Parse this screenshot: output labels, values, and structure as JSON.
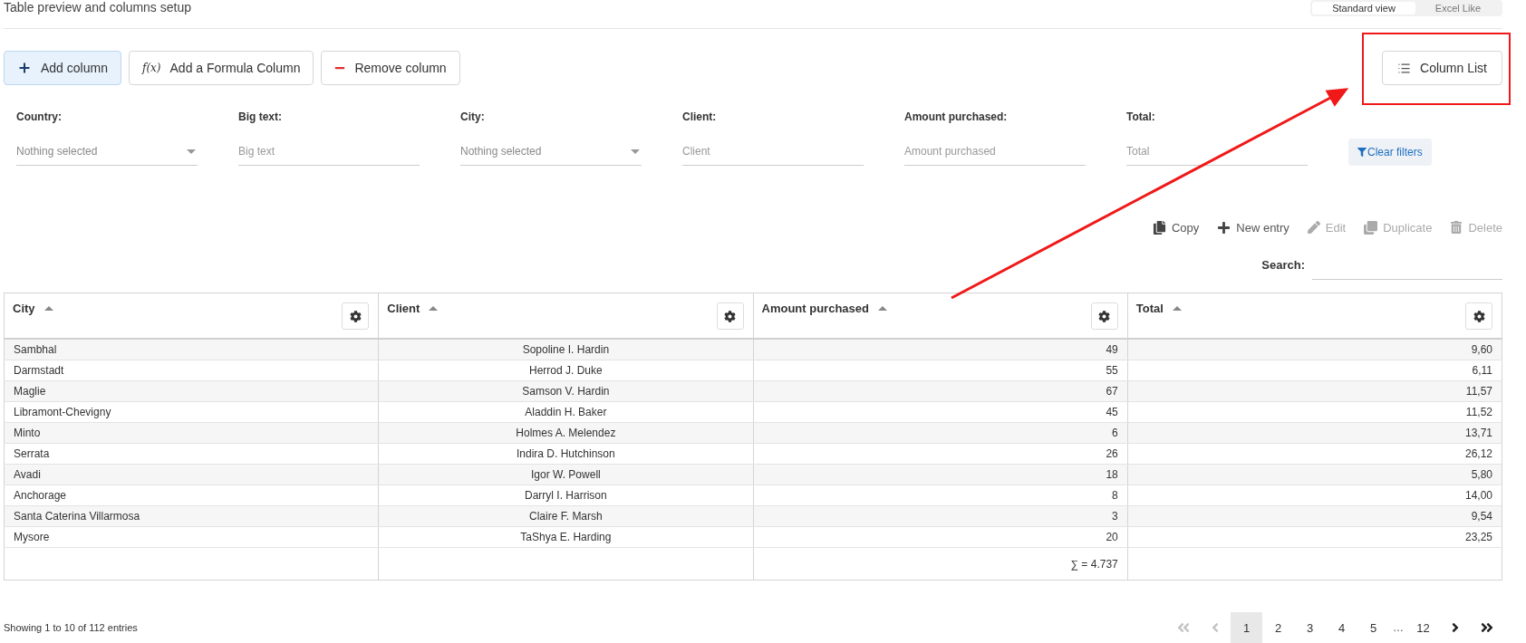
{
  "header": {
    "title": "Table preview and columns setup",
    "view_toggle": [
      {
        "label": "Standard view",
        "selected": true
      },
      {
        "label": "Excel Like",
        "selected": false
      }
    ]
  },
  "column_buttons": [
    {
      "kind": "add",
      "label": "Add column"
    },
    {
      "kind": "formula",
      "icon_text": "f(x)",
      "label": "Add a Formula Column"
    },
    {
      "kind": "remove",
      "label": "Remove column"
    }
  ],
  "column_list_button": {
    "label": "Column List"
  },
  "filters": [
    {
      "label": "Country:",
      "kind": "select",
      "placeholder": "Nothing selected"
    },
    {
      "label": "Big text:",
      "kind": "text",
      "placeholder": "Big text"
    },
    {
      "label": "City:",
      "kind": "select",
      "placeholder": "Nothing selected"
    },
    {
      "label": "Client:",
      "kind": "text",
      "placeholder": "Client"
    },
    {
      "label": "Amount purchased:",
      "kind": "text",
      "placeholder": "Amount purchased"
    },
    {
      "label": "Total:",
      "kind": "text",
      "placeholder": "Total"
    }
  ],
  "clear_filters": {
    "label": "Clear filters"
  },
  "actions": [
    {
      "kind": "copy",
      "label": "Copy",
      "disabled": false
    },
    {
      "kind": "new",
      "label": "New entry",
      "disabled": false
    },
    {
      "kind": "edit",
      "label": "Edit",
      "disabled": true
    },
    {
      "kind": "duplicate",
      "label": "Duplicate",
      "disabled": true
    },
    {
      "kind": "delete",
      "label": "Delete",
      "disabled": true
    }
  ],
  "search": {
    "label": "Search:"
  },
  "table": {
    "columns": [
      {
        "label": "City"
      },
      {
        "label": "Client"
      },
      {
        "label": "Amount purchased"
      },
      {
        "label": "Total"
      }
    ],
    "rows": [
      [
        "Sambhal",
        "Sopoline I. Hardin",
        "49",
        "9,60"
      ],
      [
        "Darmstadt",
        "Herrod J. Duke",
        "55",
        "6,11"
      ],
      [
        "Maglie",
        "Samson V. Hardin",
        "67",
        "11,57"
      ],
      [
        "Libramont-Chevigny",
        "Aladdin H. Baker",
        "45",
        "11,52"
      ],
      [
        "Minto",
        "Holmes A. Melendez",
        "6",
        "13,71"
      ],
      [
        "Serrata",
        "Indira D. Hutchinson",
        "26",
        "26,12"
      ],
      [
        "Avadi",
        "Igor W. Powell",
        "18",
        "5,80"
      ],
      [
        "Anchorage",
        "Darryl I. Harrison",
        "8",
        "14,00"
      ],
      [
        "Santa Caterina Villarmosa",
        "Claire F. Marsh",
        "3",
        "9,54"
      ],
      [
        "Mysore",
        "TaShya E. Harding",
        "20",
        "23,25"
      ]
    ],
    "footer": {
      "sum": "∑ = 4.737"
    }
  },
  "status": "Showing 1 to 10 of 112 entries",
  "pagination": [
    {
      "kind": "first",
      "disabled": true
    },
    {
      "kind": "prev",
      "disabled": true
    },
    {
      "kind": "page",
      "label": "1",
      "selected": true
    },
    {
      "kind": "page",
      "label": "2",
      "selected": false
    },
    {
      "kind": "page",
      "label": "3",
      "selected": false
    },
    {
      "kind": "page",
      "label": "4",
      "selected": false
    },
    {
      "kind": "page",
      "label": "5",
      "selected": false
    },
    {
      "kind": "ellipsis",
      "label": "…"
    },
    {
      "kind": "page",
      "label": "12",
      "selected": false
    },
    {
      "kind": "next",
      "disabled": false
    },
    {
      "kind": "last",
      "disabled": false
    }
  ]
}
